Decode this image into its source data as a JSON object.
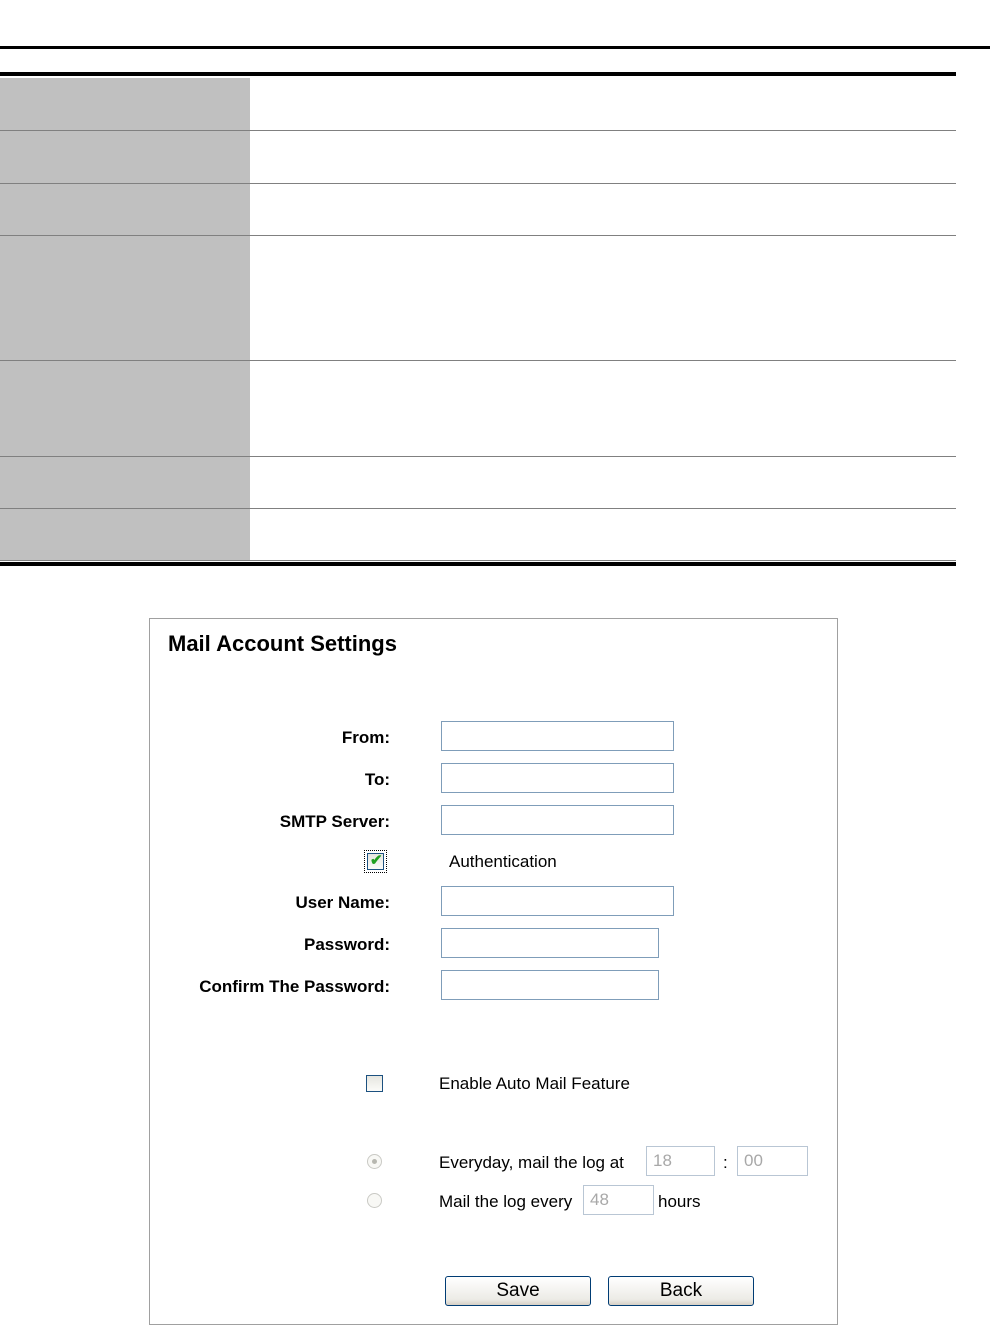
{
  "table_rows": 7,
  "mail": {
    "title": "Mail Account Settings",
    "from_label": "From:",
    "from_value": "",
    "to_label": "To:",
    "to_value": "",
    "smtp_label": "SMTP Server:",
    "smtp_value": "",
    "auth_label": "Authentication",
    "auth_checked": true,
    "user_label": "User Name:",
    "user_value": "",
    "password_label": "Password:",
    "password_value": "",
    "confirm_label": "Confirm The Password:",
    "confirm_value": "",
    "auto_mail_label": "Enable Auto Mail Feature",
    "auto_mail_checked": false,
    "everyday_label": "Everyday, mail the log at",
    "everyday_selected": true,
    "hour_value": "18",
    "colon": ":",
    "minute_value": "00",
    "every_label": "Mail the log every",
    "every_selected": false,
    "every_value": "48",
    "hours_label": "hours",
    "save_label": "Save",
    "back_label": "Back"
  },
  "icons": {
    "checkbox_checked": "checkmark-icon"
  }
}
